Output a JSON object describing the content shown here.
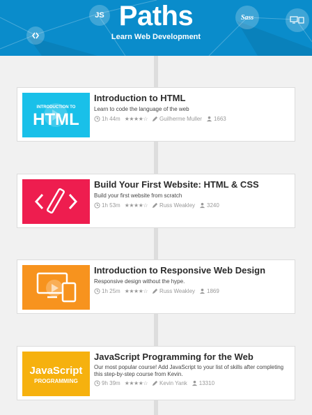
{
  "header": {
    "title": "Paths",
    "subtitle": "Learn Web Development",
    "icons": [
      {
        "name": "js-icon",
        "text": "JS"
      },
      {
        "name": "code-icon",
        "text": "‹›"
      },
      {
        "name": "sass-icon",
        "text": "Sass"
      },
      {
        "name": "devices-icon",
        "text": "▭▯"
      }
    ]
  },
  "courses": [
    {
      "title": "Introduction to HTML",
      "description": "Learn to code the language of the web",
      "duration": "1h 44m",
      "rating": "★★★★☆",
      "author": "Guilherme Muller",
      "students": "1663",
      "thumb_small": "INTRODUCTION TO",
      "thumb_big": "HTML",
      "thumb_color": "#19c0e9"
    },
    {
      "title": "Build Your First Website: HTML & CSS",
      "description": "Build your first website from scratch",
      "duration": "1h 53m",
      "rating": "★★★★☆",
      "author": "Russ Weakley",
      "students": "3240",
      "thumb_color": "#ee1d4f"
    },
    {
      "title": "Introduction to Responsive Web Design",
      "description": "Responsive design without the hype.",
      "duration": "1h 25m",
      "rating": "★★★★☆",
      "author": "Russ Weakley",
      "students": "1869",
      "thumb_color": "#f7931e"
    },
    {
      "title": "JavaScript Programming for the Web",
      "description": "Our most popular course! Add JavaScript to your list of skills after completing this step-by-step course from Kevin.",
      "duration": "9h 39m",
      "rating": "★★★★☆",
      "author": "Kevin Yank",
      "students": "13310",
      "thumb_big": "JavaScript",
      "thumb_small": "PROGRAMMING",
      "thumb_color": "#f6b10e"
    }
  ]
}
